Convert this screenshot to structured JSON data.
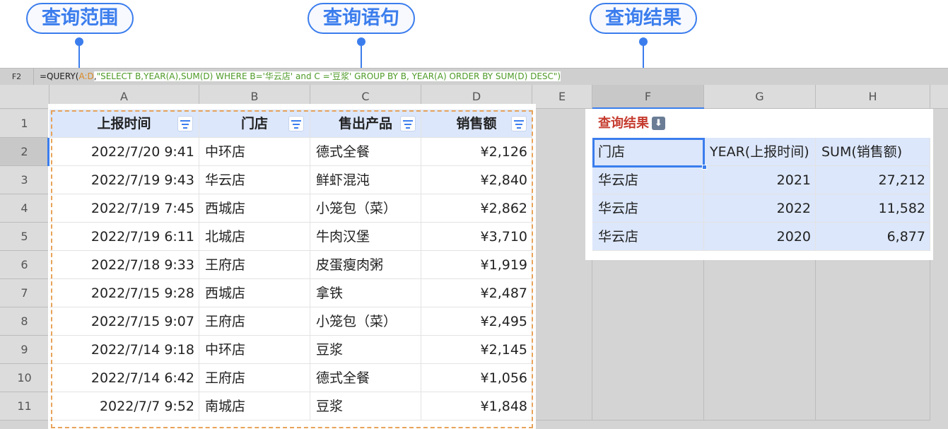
{
  "callouts": {
    "range": "查询范围",
    "query": "查询语句",
    "result": "查询结果"
  },
  "formula_bar": {
    "cell_ref": "F2",
    "fn": "=QUERY(",
    "range": "A:D",
    "comma": ",",
    "query_a": "\"SELECT B,YEAR(A),SUM(D) WHERE B='华云店' and C ='豆浆",
    "query_b": "' GROUP BY B, YEAR(A) ORDER BY SUM(D) DESC\")"
  },
  "columns": [
    "A",
    "B",
    "C",
    "D",
    "E",
    "F",
    "G",
    "H"
  ],
  "rows": [
    "1",
    "2",
    "3",
    "4",
    "5",
    "6",
    "7",
    "8",
    "9",
    "10",
    "11"
  ],
  "source_table": {
    "headers": [
      "上报时间",
      "门店",
      "售出产品",
      "销售额"
    ],
    "rows": [
      [
        "2022/7/20 9:41",
        "中环店",
        "德式全餐",
        "¥2,126"
      ],
      [
        "2022/7/19 9:43",
        "华云店",
        "鲜虾混沌",
        "¥2,840"
      ],
      [
        "2022/7/19 7:45",
        "西城店",
        "小笼包（菜）",
        "¥2,862"
      ],
      [
        "2022/7/19 6:11",
        "北城店",
        "牛肉汉堡",
        "¥3,710"
      ],
      [
        "2022/7/18 9:33",
        "王府店",
        "皮蛋瘦肉粥",
        "¥1,919"
      ],
      [
        "2022/7/15 9:28",
        "西城店",
        "拿铁",
        "¥2,487"
      ],
      [
        "2022/7/15 9:07",
        "王府店",
        "小笼包（菜）",
        "¥2,495"
      ],
      [
        "2022/7/14 9:18",
        "中环店",
        "豆浆",
        "¥2,145"
      ],
      [
        "2022/7/14 6:42",
        "王府店",
        "德式全餐",
        "¥1,056"
      ],
      [
        "2022/7/7 9:52",
        "南城店",
        "豆浆",
        "¥1,848"
      ]
    ]
  },
  "result": {
    "label": "查询结果",
    "headers": [
      "门店",
      "YEAR(上报时间)",
      "SUM(销售额)"
    ],
    "rows": [
      [
        "华云店",
        "2021",
        "27,212"
      ],
      [
        "华云店",
        "2022",
        "11,582"
      ],
      [
        "华云店",
        "2020",
        "6,877"
      ]
    ]
  },
  "colors": {
    "accent": "#3b7ded",
    "header_fill": "#dce7fb",
    "range_border": "#e8a35a",
    "result_label": "#c53b2e"
  }
}
